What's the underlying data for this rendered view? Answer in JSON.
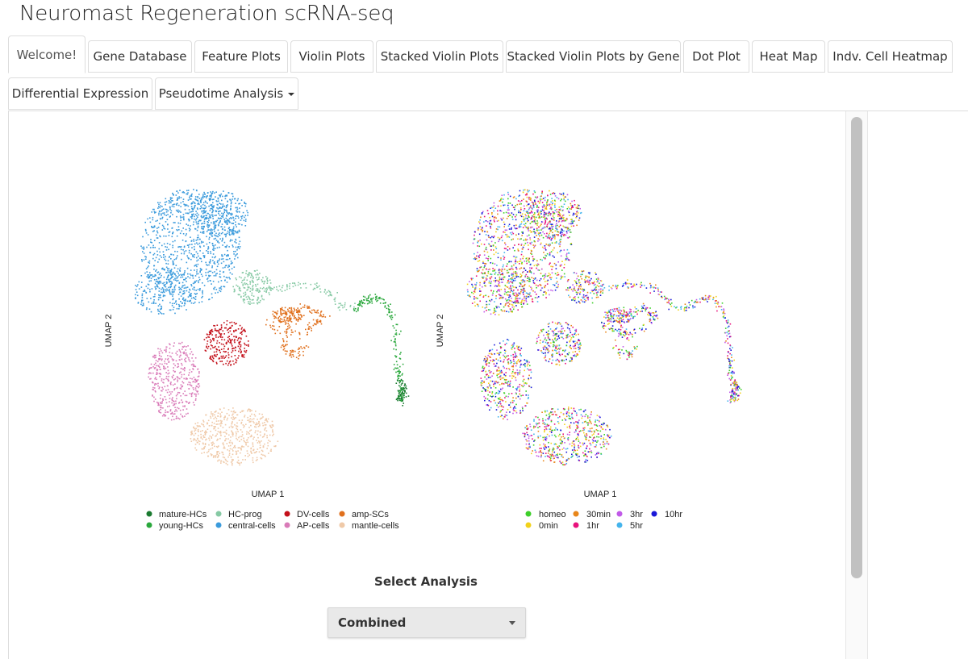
{
  "app": {
    "title": "Neuromast Regeneration scRNA-seq"
  },
  "tabs": [
    {
      "label": "Welcome!",
      "active": true
    },
    {
      "label": "Gene Database"
    },
    {
      "label": "Feature Plots"
    },
    {
      "label": "Violin Plots"
    },
    {
      "label": "Stacked Violin Plots"
    },
    {
      "label": "Stacked Violin Plots by Gene"
    },
    {
      "label": "Dot Plot"
    },
    {
      "label": "Heat Map"
    },
    {
      "label": "Indv. Cell Heatmap"
    },
    {
      "label": "Differential Expression"
    },
    {
      "label": "Pseudotime Analysis",
      "dropdown": true
    }
  ],
  "chart_data": [
    {
      "type": "scatter",
      "xlabel": "UMAP 1",
      "ylabel": "UMAP 2",
      "grid": false,
      "legend_position": "bottom",
      "series": [
        {
          "name": "mature-HCs",
          "color": "#1a7a30"
        },
        {
          "name": "young-HCs",
          "color": "#2aa83c"
        },
        {
          "name": "HC-prog",
          "color": "#86c9a4"
        },
        {
          "name": "central-cells",
          "color": "#3b9bdc"
        },
        {
          "name": "DV-cells",
          "color": "#c4101a"
        },
        {
          "name": "AP-cells",
          "color": "#d97bb8"
        },
        {
          "name": "amp-SCs",
          "color": "#e0701d"
        },
        {
          "name": "mantle-cells",
          "color": "#efc9a8"
        }
      ]
    },
    {
      "type": "scatter",
      "xlabel": "UMAP 1",
      "ylabel": "UMAP 2",
      "grid": false,
      "legend_position": "bottom",
      "series": [
        {
          "name": "homeo",
          "color": "#3dcf2a"
        },
        {
          "name": "0min",
          "color": "#f2d21a"
        },
        {
          "name": "30min",
          "color": "#e8861a"
        },
        {
          "name": "1hr",
          "color": "#e8127c"
        },
        {
          "name": "3hr",
          "color": "#c15ae8"
        },
        {
          "name": "5hr",
          "color": "#45b4ec"
        },
        {
          "name": "10hr",
          "color": "#1a18d8"
        }
      ]
    }
  ],
  "select": {
    "label": "Select Analysis",
    "value": "Combined"
  }
}
